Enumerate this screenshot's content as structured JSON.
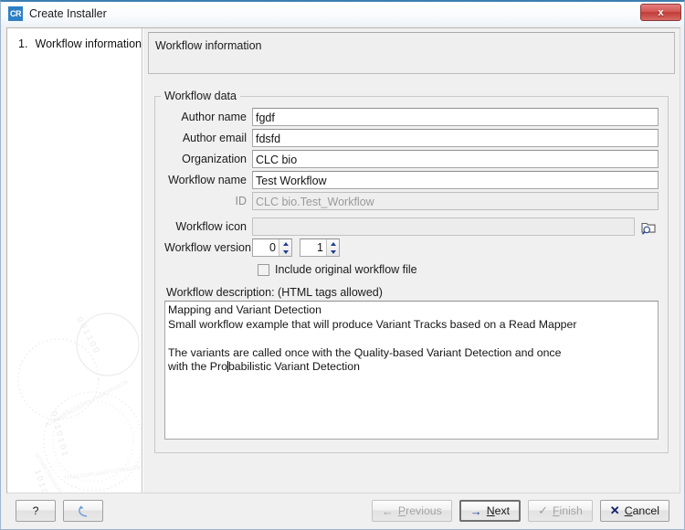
{
  "window": {
    "title": "Create Installer",
    "app_icon_label": "CR",
    "close_label": "x"
  },
  "sidebar": {
    "steps": [
      {
        "number": "1.",
        "label": "Workflow information"
      }
    ]
  },
  "pane": {
    "header": "Workflow information"
  },
  "group": {
    "title": "Workflow data",
    "fields": [
      {
        "label": "Author name",
        "value": "fgdf",
        "disabled": false
      },
      {
        "label": "Author email",
        "value": "fdsfd",
        "disabled": false
      },
      {
        "label": "Organization",
        "value": "CLC bio",
        "disabled": false
      },
      {
        "label": "Workflow name",
        "value": "Test Workflow",
        "disabled": false
      },
      {
        "label": "ID",
        "value": "CLC bio.Test_Workflow",
        "disabled": true
      }
    ],
    "icon_row": {
      "label": "Workflow icon",
      "value": "",
      "browse_icon": "folder-search-icon"
    },
    "version_row": {
      "label": "Workflow version",
      "major": "0",
      "minor": "1"
    },
    "checkbox": {
      "label": "Include original workflow file",
      "checked": false
    },
    "description": {
      "label": "Workflow description: (HTML tags allowed)",
      "text_before_caret": "Mapping and Variant Detection\nSmall workflow example that will produce Variant Tracks based on a Read Mapper\n\nThe variants are called once with the Quality-based Variant Detection and once\nwith the Pro",
      "text_after_caret": "babilistic Variant Detection",
      "full_text": "Mapping and Variant Detection\nSmall workflow example that will produce Variant Tracks based on a Read Mapper\n\nThe variants are called once with the Quality-based Variant Detection and once\nwith the Probabilistic Variant Detection"
    }
  },
  "footer": {
    "help_label": "?",
    "reset_icon": "undo-arrow-icon",
    "previous": {
      "label": "Previous",
      "mnemonic": "P",
      "rest": "revious",
      "icon": "arrow-left-icon",
      "disabled": true
    },
    "next": {
      "label": "Next",
      "mnemonic": "N",
      "rest": "ext",
      "icon": "arrow-right-icon",
      "disabled": false,
      "default": true
    },
    "finish": {
      "label": "Finish",
      "mnemonic": "F",
      "rest": "inish",
      "icon": "check-icon",
      "disabled": true
    },
    "cancel": {
      "label": "Cancel",
      "mnemonic": "C",
      "rest": "ancel",
      "icon": "x-icon",
      "disabled": false
    }
  },
  "colors": {
    "accent": "#3c7fb1",
    "app_icon": "#2e7fc4",
    "close_red": "#c03c38",
    "glyph_blue": "#1f3f8f",
    "window_bg": "#f0f0f0"
  }
}
